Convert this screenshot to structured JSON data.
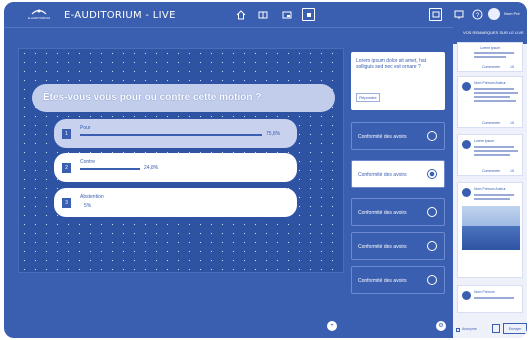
{
  "header": {
    "logo_text": "E-AUDITORIUM",
    "title": "E-AUDITORIUM - LIVE",
    "user_name": "Nom Pré",
    "icons": [
      "home-icon",
      "screens-icon",
      "screen-share-icon",
      "fullscreen-icon",
      "chat-icon",
      "present-icon",
      "help-icon"
    ]
  },
  "poll": {
    "question": "Êtes-vous vous pour ou contre cette motion ?",
    "answers": [
      {
        "num": "1",
        "label": "Pour",
        "percent_text": "75,8%",
        "percent": 75.8
      },
      {
        "num": "2",
        "label": "Contre",
        "percent_text": "24,8%",
        "percent": 24.8
      },
      {
        "num": "3",
        "label": "Abstention",
        "percent_text": "5%",
        "percent": 5
      }
    ]
  },
  "questions_panel": {
    "featured_text": "Lorem ipsum dolor sit amet, hat solliguis sed nec est ornare ?",
    "featured_button": "Répondre",
    "items": [
      {
        "label": "Conformité des avoirs"
      },
      {
        "label": "Conformité des avoirs"
      },
      {
        "label": "Conformité des avoirs"
      },
      {
        "label": "Conformité des avoirs"
      },
      {
        "label": "Conformité des avoirs"
      }
    ]
  },
  "right_panel": {
    "header": "VOS REMARQUES SUR LE LIVE",
    "posts": [
      {
        "author": "Lorem ipsum",
        "meta_a": "Commenter",
        "meta_b": "15"
      },
      {
        "author": "Nom Prénom Auteur",
        "meta_a": "Commenter",
        "meta_b": "15"
      },
      {
        "author": "Lorem ipsum",
        "meta_a": "Commenter",
        "meta_b": "15"
      },
      {
        "author": "Nom Prénom Auteur",
        "meta_a": "",
        "meta_b": ""
      },
      {
        "author": "Nom Prénom",
        "meta_a": "",
        "meta_b": ""
      }
    ],
    "footer_checkbox": "Anonyme",
    "send_label": "Envoyer"
  },
  "colors": {
    "primary": "#3a5eb0",
    "panel": "#eef1fa",
    "white": "#ffffff"
  }
}
